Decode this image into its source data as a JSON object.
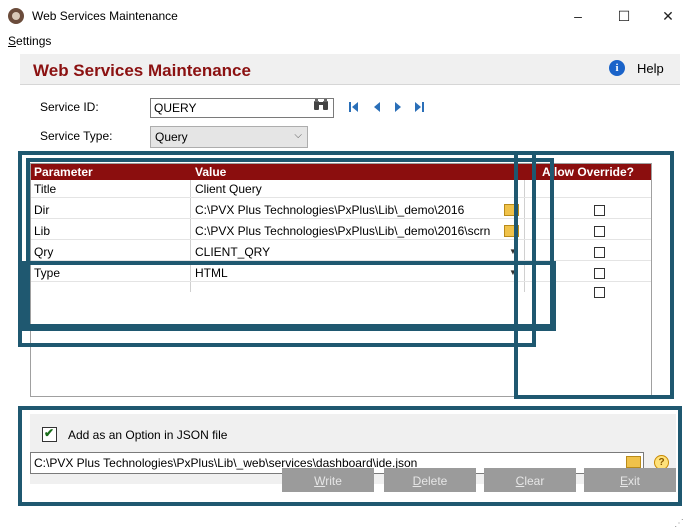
{
  "window": {
    "title": "Web Services Maintenance",
    "minimize_glyph": "–",
    "maximize_glyph": "☐",
    "close_glyph": "✕"
  },
  "menu": {
    "settings": "Settings"
  },
  "header": {
    "title": "Web Services Maintenance",
    "help_label": "Help",
    "help_icon": "info-icon"
  },
  "form": {
    "service_id_label": "Service ID:",
    "service_id_value": "QUERY",
    "service_type_label": "Service Type:",
    "service_type_value": "Query"
  },
  "grid": {
    "columns": {
      "parameter": "Parameter",
      "value": "Value",
      "allow_override": "Allow Override?"
    },
    "rows": [
      {
        "parameter": "Title",
        "value": "Client Query",
        "control": "none",
        "override": null
      },
      {
        "parameter": "Dir",
        "value": "C:\\PVX Plus Technologies\\PxPlus\\Lib\\_demo\\2016",
        "control": "folder",
        "override": false
      },
      {
        "parameter": "Lib",
        "value": "C:\\PVX Plus Technologies\\PxPlus\\Lib\\_demo\\2016\\scrn",
        "control": "folder",
        "override": false
      },
      {
        "parameter": "Qry",
        "value": "CLIENT_QRY",
        "control": "dropdown",
        "override": false
      },
      {
        "parameter": "Type",
        "value": "HTML",
        "control": "dropdown",
        "override": false
      },
      {
        "parameter": "",
        "value": "",
        "control": "none",
        "override": false
      }
    ]
  },
  "json_option": {
    "checked": true,
    "label": "Add as an Option in JSON file",
    "path": "C:\\PVX Plus Technologies\\PxPlus\\Lib\\_web\\services\\dashboard\\ide.json"
  },
  "buttons": {
    "write": "Write",
    "delete": "Delete",
    "clear": "Clear",
    "exit": "Exit"
  },
  "colors": {
    "header_title": "#8b1111",
    "grid_header": "#8b0e0e",
    "highlight_box": "#1f5870"
  }
}
